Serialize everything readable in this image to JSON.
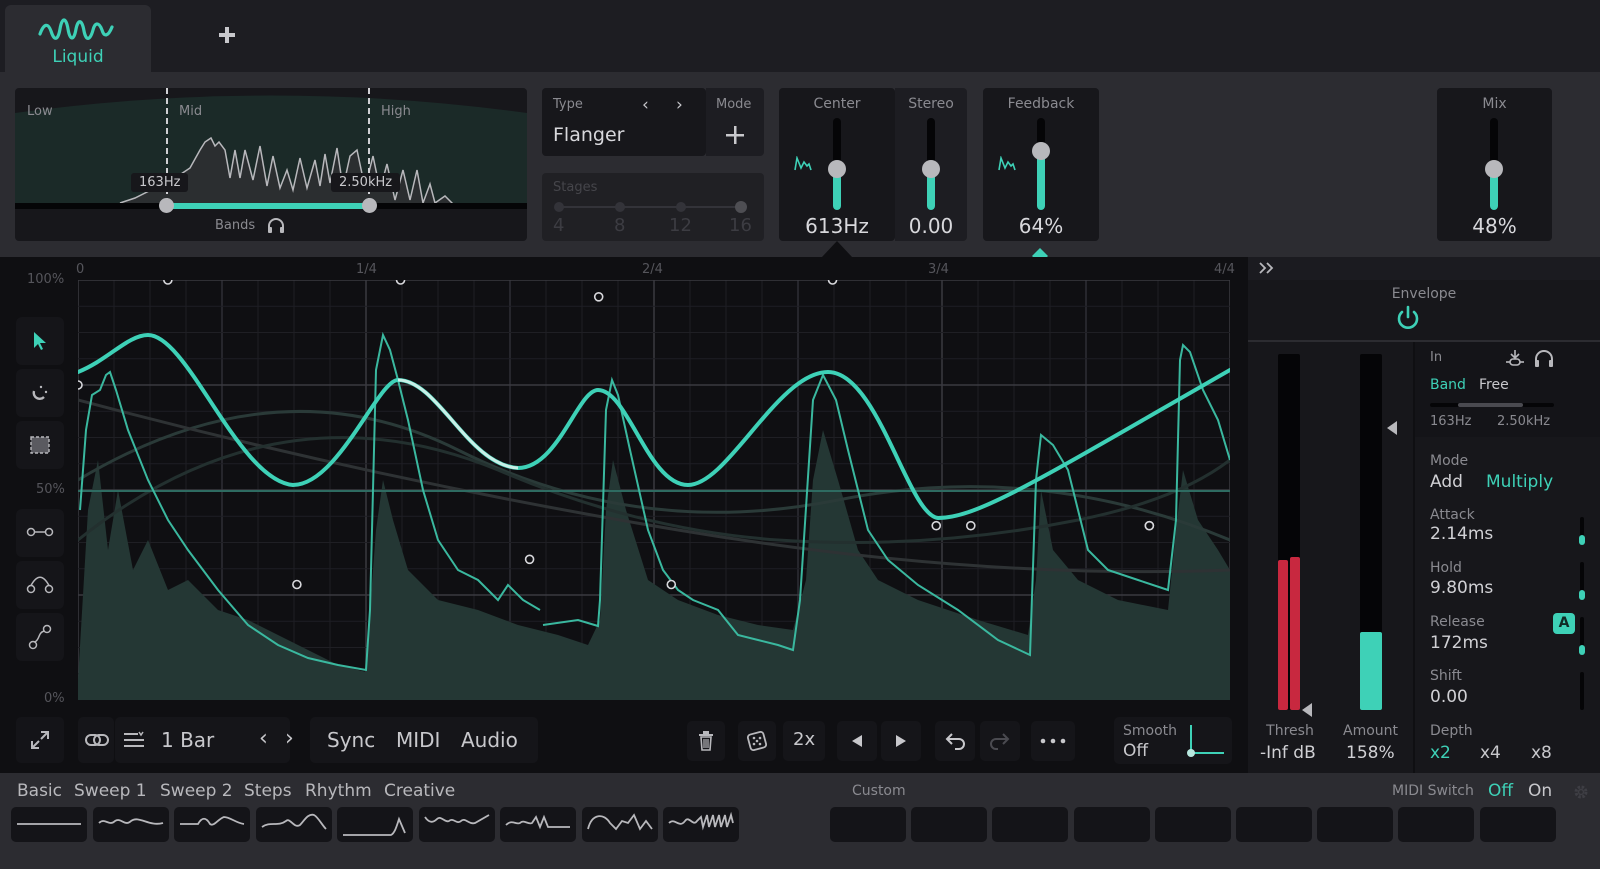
{
  "header": {
    "tabs": [
      {
        "label": "Liquid",
        "icon": "wave-icon",
        "active": true
      }
    ],
    "add_tab_icon": "plus-icon"
  },
  "bands": {
    "labels": {
      "low": "Low",
      "mid": "Mid",
      "high": "High"
    },
    "low_freq": "163Hz",
    "high_freq": "2.50kHz",
    "footer_label": "Bands",
    "solo_icon": "headphones-icon"
  },
  "type": {
    "label": "Type",
    "value": "Flanger",
    "prev_icon": "chevron-left-icon",
    "next_icon": "chevron-right-icon",
    "mode_label": "Mode",
    "mode_icon": "plus-icon"
  },
  "stages": {
    "label": "Stages",
    "options": [
      "4",
      "8",
      "12",
      "16"
    ],
    "selected": "16"
  },
  "knobs": {
    "center": {
      "label": "Center",
      "value": "613Hz",
      "level": 0.45,
      "modulated": true
    },
    "stereo": {
      "label": "Stereo",
      "value": "0.00",
      "level": 0.45
    },
    "feedback": {
      "label": "Feedback",
      "value": "64%",
      "level": 0.64,
      "modulated": true
    },
    "mix": {
      "label": "Mix",
      "value": "48%",
      "level": 0.45
    }
  },
  "editor": {
    "x_ticks": [
      "0",
      "1/4",
      "2/4",
      "3/4",
      "4/4"
    ],
    "y_ticks": [
      "100%",
      "50%",
      "0%"
    ],
    "tools": [
      {
        "name": "select-tool",
        "icon": "pointer-icon",
        "active": true
      },
      {
        "name": "snap-tool",
        "icon": "magnet-icon"
      },
      {
        "name": "marquee-tool",
        "icon": "marquee-icon"
      },
      {
        "name": "line-tool",
        "icon": "line-segment-icon"
      },
      {
        "name": "arc-tool",
        "icon": "arc-icon"
      },
      {
        "name": "scurve-tool",
        "icon": "s-curve-icon"
      }
    ],
    "lfo_points": [
      [
        0.0,
        0.75
      ],
      [
        0.078,
        1.0
      ],
      [
        0.28,
        1.0
      ],
      [
        0.452,
        0.96
      ],
      [
        0.655,
        1.0
      ],
      [
        0.93,
        0.415
      ],
      [
        0.93,
        0.415
      ],
      [
        0.19,
        0.275
      ],
      [
        0.392,
        0.335
      ],
      [
        0.515,
        0.275
      ],
      [
        0.745,
        0.415
      ],
      [
        0.775,
        0.415
      ]
    ]
  },
  "toolbar": {
    "expand_icon": "expand-icon",
    "link_icon": "link-icon",
    "rate_menu_icon": "rate-menu-icon",
    "rate": "1 Bar",
    "prev_icon": "chevron-left-icon",
    "next_icon": "chevron-right-icon",
    "trigger_modes": [
      {
        "label": "Sync",
        "active": true
      },
      {
        "label": "MIDI",
        "active": false
      },
      {
        "label": "Audio",
        "active": false
      }
    ],
    "delete_icon": "trash-icon",
    "random_icon": "dice-icon",
    "multiply": "2x",
    "shift_left_icon": "triangle-left-icon",
    "shift_right_icon": "triangle-right-icon",
    "undo_icon": "undo-icon",
    "redo_icon": "redo-icon",
    "more_icon": "more-dots-icon",
    "smooth_label": "Smooth",
    "smooth_value": "Off"
  },
  "envelope": {
    "collapse_icon": "double-chevron-right-icon",
    "title": "Envelope",
    "power_icon": "power-icon",
    "thresh_label": "Thresh",
    "thresh_value": "-Inf dB",
    "thresh_level_l": 0.42,
    "thresh_level_r": 0.43,
    "amount_label": "Amount",
    "amount_value": "158%",
    "amount_level": 0.22,
    "in_label": "In",
    "in_options": [
      {
        "label": "Band",
        "active": true
      },
      {
        "label": "Free",
        "active": false
      }
    ],
    "sidechain_icon": "sidechain-icon",
    "headphones_icon": "headphones-icon",
    "range_low": "163Hz",
    "range_high": "2.50kHz",
    "mode_label": "Mode",
    "mode_options": [
      {
        "label": "Add",
        "active": false
      },
      {
        "label": "Multiply",
        "active": true
      }
    ],
    "attack_label": "Attack",
    "attack_value": "2.14ms",
    "hold_label": "Hold",
    "hold_value": "9.80ms",
    "release_label": "Release",
    "release_value": "172ms",
    "release_auto": "A",
    "shift_label": "Shift",
    "shift_value": "0.00",
    "depth_label": "Depth",
    "depth_options": [
      {
        "label": "x2",
        "active": true
      },
      {
        "label": "x4",
        "active": false
      },
      {
        "label": "x8",
        "active": false
      }
    ]
  },
  "presets": {
    "categories": [
      {
        "label": "Basic",
        "active": false
      },
      {
        "label": "Sweep 1",
        "active": false
      },
      {
        "label": "Sweep 2",
        "active": true
      },
      {
        "label": "Steps",
        "active": false
      },
      {
        "label": "Rhythm",
        "active": false
      },
      {
        "label": "Creative",
        "active": false
      }
    ],
    "shapes": [
      "flat",
      "wobble",
      "step-wave",
      "sine-rise",
      "ramp-spike",
      "zigzag",
      "wave-dip",
      "hump-wave",
      "noise-wave"
    ],
    "custom_label": "Custom",
    "custom_slots": 9,
    "midi_switch_label": "MIDI Switch",
    "midi_switch_options": [
      {
        "label": "Off",
        "active": true
      },
      {
        "label": "On",
        "active": false
      }
    ],
    "settings_icon": "gear-icon"
  },
  "colors": {
    "accent": "#3ed1b7",
    "meter_red": "#c8283f",
    "background": "#2c2c31",
    "panel": "#17171b"
  }
}
